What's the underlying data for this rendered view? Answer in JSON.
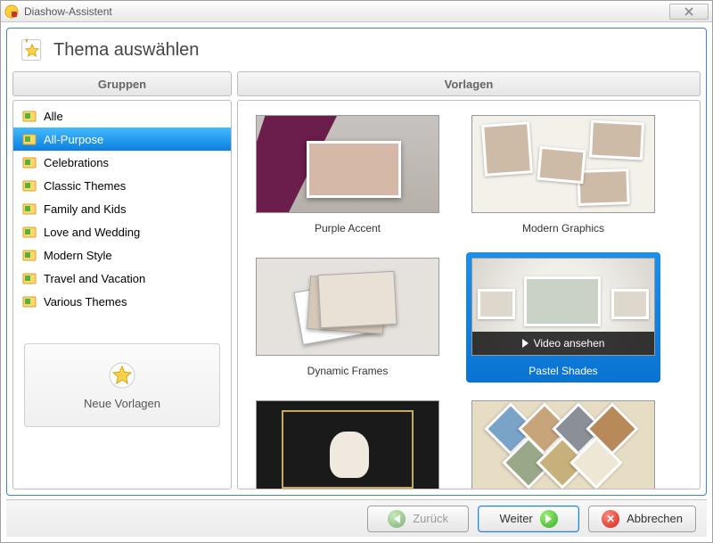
{
  "window": {
    "title": "Diashow-Assistent"
  },
  "header": {
    "title": "Thema auswählen"
  },
  "columns": {
    "groups_label": "Gruppen",
    "templates_label": "Vorlagen"
  },
  "groups": {
    "items": [
      {
        "label": "Alle",
        "selected": false
      },
      {
        "label": "All-Purpose",
        "selected": true
      },
      {
        "label": "Celebrations",
        "selected": false
      },
      {
        "label": "Classic Themes",
        "selected": false
      },
      {
        "label": "Family and Kids",
        "selected": false
      },
      {
        "label": "Love and Wedding",
        "selected": false
      },
      {
        "label": "Modern Style",
        "selected": false
      },
      {
        "label": "Travel and Vacation",
        "selected": false
      },
      {
        "label": "Various Themes",
        "selected": false
      }
    ],
    "new_button": "Neue Vorlagen"
  },
  "templates": {
    "items": [
      {
        "label": "Purple Accent",
        "selected": false,
        "overlay": null
      },
      {
        "label": "Modern Graphics",
        "selected": false,
        "overlay": null
      },
      {
        "label": "Dynamic Frames",
        "selected": false,
        "overlay": null
      },
      {
        "label": "Pastel Shades",
        "selected": true,
        "overlay": "Video ansehen"
      },
      {
        "label": "",
        "selected": false,
        "overlay": null
      },
      {
        "label": "",
        "selected": false,
        "overlay": null
      }
    ]
  },
  "footer": {
    "back": "Zurück",
    "next": "Weiter",
    "cancel": "Abbrechen"
  }
}
